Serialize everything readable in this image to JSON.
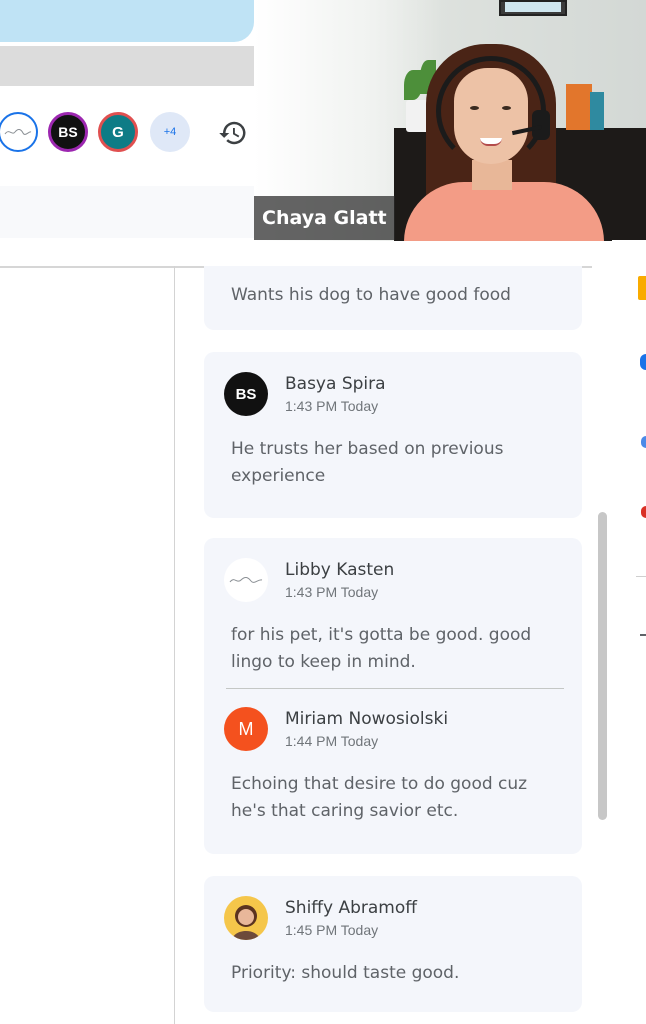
{
  "toolbar": {
    "avatars": [
      {
        "initials": "signature",
        "name": "signature avatar"
      },
      {
        "initials": "BS",
        "name": "Basya Spira"
      },
      {
        "initials": "G",
        "name": "G"
      },
      {
        "initials": "+4",
        "name": "more participants"
      }
    ],
    "history_icon": "history-icon"
  },
  "video": {
    "participant_name": "Chaya Glatt"
  },
  "comments": {
    "first_card_text": "Wants his dog to have good food",
    "threads": [
      {
        "author": "Basya Spira",
        "time": "1:43 PM Today",
        "avatar_initials": "BS",
        "text": "He trusts her based on previous experience"
      },
      {
        "author": "Libby Kasten",
        "time": "1:43 PM Today",
        "avatar_initials": "signature",
        "text": "for his pet, it's gotta be good. good lingo to keep in mind."
      },
      {
        "author": "Miriam Nowosiolski",
        "time": "1:44 PM Today",
        "avatar_initials": "M",
        "text": "Echoing that desire to do good cuz he's that caring savior etc."
      },
      {
        "author": "Shiffy Abramoff",
        "time": "1:45 PM Today",
        "avatar_initials": "photo",
        "text": "Priority: should taste good."
      }
    ]
  },
  "colors": {
    "accent": "#1a73e8",
    "card_bg": "#f4f6fb",
    "miriam_avatar": "#f4511e",
    "name_tag_bg": "#282828"
  }
}
